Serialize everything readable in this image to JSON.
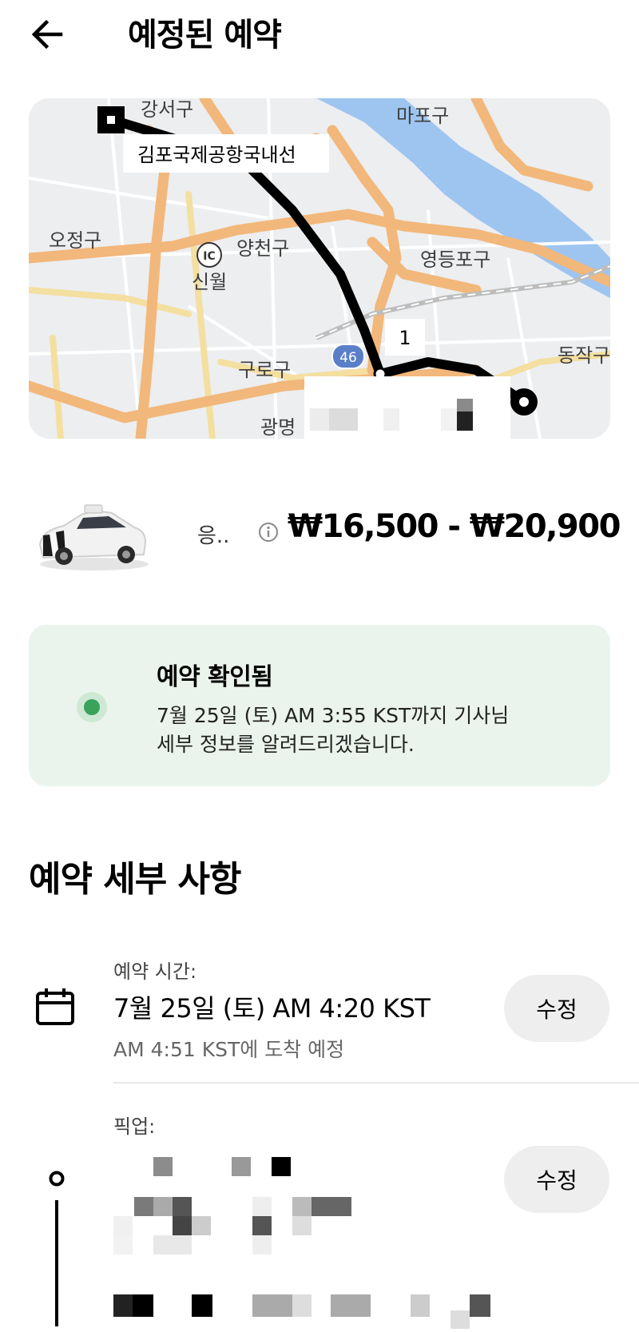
{
  "header": {
    "title": "예정된 예약",
    "back_icon": "arrow-left-icon"
  },
  "map": {
    "labels": {
      "gangseo": "강서구",
      "mapo": "마포구",
      "ojeong": "오정구",
      "yangcheon": "양천구",
      "sinwol": "신월",
      "yeongdeungpo": "영등포구",
      "guro": "구로구",
      "dongjak": "동작구",
      "gwangmyeong": "광명",
      "ic": "IC",
      "route46": "46"
    },
    "pickup_callout": "김포국제공항국내선",
    "stop_callout": "1"
  },
  "ride": {
    "name": "응..",
    "info_icon": "info-icon",
    "price": "₩16,500 - ₩20,900"
  },
  "status": {
    "title": "예약 확인됨",
    "line1": "7월 25일 (토) AM 3:55 KST까지 기사님",
    "line2": "세부 정보를 알려드리겠습니다.",
    "color": "#3aa25a"
  },
  "details": {
    "heading": "예약 세부 사항",
    "time": {
      "caption": "예약 시간:",
      "value": "7월 25일 (토) AM 4:20 KST",
      "arrival": "AM 4:51 KST에 도착 예정",
      "edit_label": "수정"
    },
    "pickup": {
      "caption": "픽업:",
      "edit_label": "수정"
    }
  }
}
